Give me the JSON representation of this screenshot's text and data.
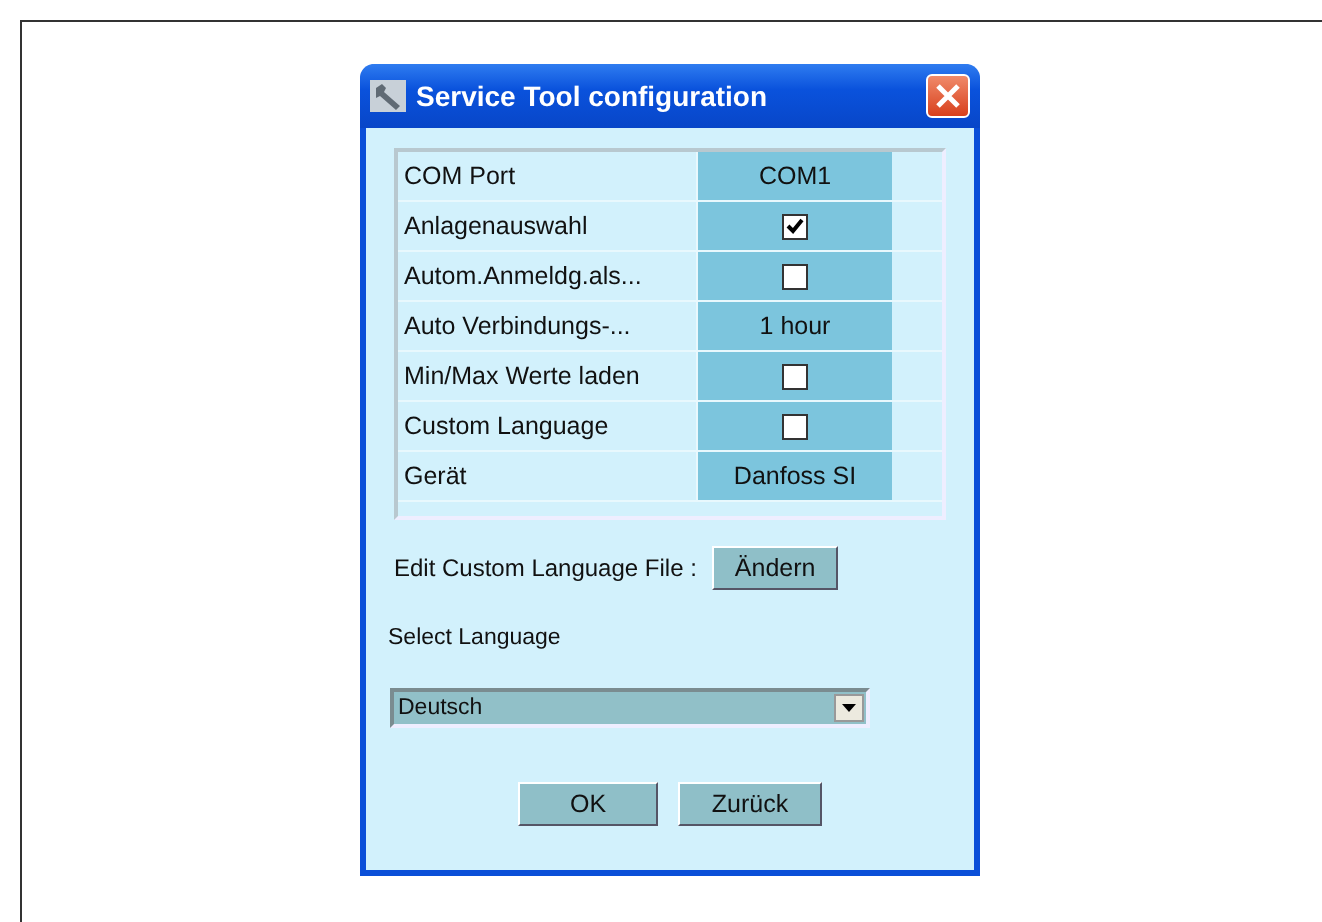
{
  "window": {
    "title": "Service Tool configuration"
  },
  "settings": [
    {
      "label": "COM Port",
      "kind": "text",
      "value": "COM1"
    },
    {
      "label": "Anlagenauswahl",
      "kind": "checkbox",
      "checked": true
    },
    {
      "label": "Autom.Anmeldg.als...",
      "kind": "checkbox",
      "checked": false
    },
    {
      "label": "Auto Verbindungs-...",
      "kind": "text",
      "value": "1 hour"
    },
    {
      "label": "Min/Max Werte laden",
      "kind": "checkbox",
      "checked": false
    },
    {
      "label": "Custom Language",
      "kind": "checkbox",
      "checked": false
    },
    {
      "label": "Gerät",
      "kind": "text",
      "value": "Danfoss SI"
    }
  ],
  "custom_language_file": {
    "label": "Edit Custom Language File :",
    "button": "Ändern"
  },
  "language": {
    "label": "Select Language",
    "value": "Deutsch"
  },
  "buttons": [
    "OK",
    "Zurück"
  ]
}
